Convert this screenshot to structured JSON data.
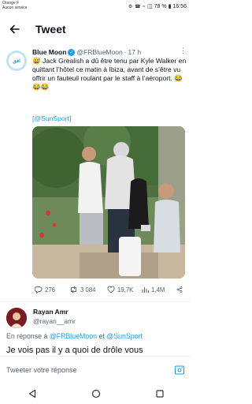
{
  "status_bar": {
    "carrier": "Orange F",
    "service": "Aucun service",
    "battery": "78 %",
    "time": "16:56"
  },
  "header": {
    "title": "Tweet"
  },
  "tweet": {
    "author_name": "Blue Moon",
    "author_handle": "@FRBlueMoon",
    "time_ago": "17 h",
    "avatar_text": "افق",
    "text": "😅 Jack Grealish a dû être tenu par Kyle Walker en quittant l’hôtel ce matin à Ibiza, avant de s’être vu offrir un fauteuil roulant par le staff à l’aéroport. 😂😂😂",
    "source": "[@SunSport]",
    "stats": {
      "replies": "276",
      "retweets": "3 084",
      "likes": "19,7K",
      "views": "1,4M"
    }
  },
  "reply": {
    "author_name": "Rayan Amr",
    "author_handle": "@rayan__amr",
    "replying_prefix": "En réponse à ",
    "replying_to_1": "@FRBlueMoon",
    "replying_and": " et ",
    "replying_to_2": "@SunSport",
    "text": "Je vois pas il y a quoi de drôle vous"
  },
  "compose": {
    "placeholder": "Tweeter votre réponse"
  },
  "colors": {
    "accent": "#1d9bf0",
    "text": "#0f1419",
    "muted": "#536471"
  },
  "icons": [
    "back-arrow-icon",
    "verified-icon",
    "more-icon",
    "reply-icon",
    "retweet-icon",
    "like-icon",
    "views-icon",
    "share-icon",
    "image-icon",
    "nav-back-icon",
    "nav-home-icon",
    "nav-recents-icon"
  ]
}
